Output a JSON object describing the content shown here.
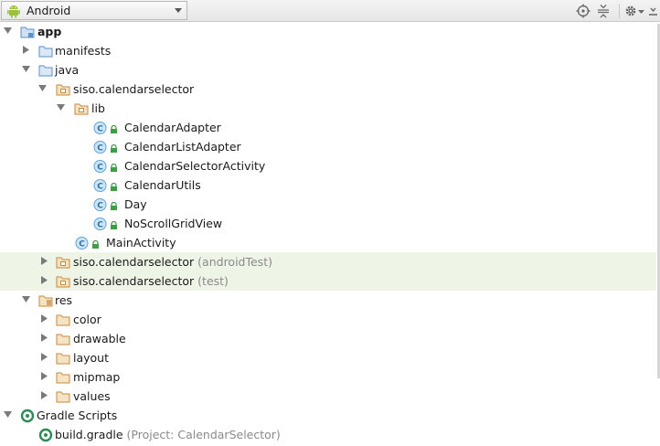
{
  "toolbar": {
    "view_label": "Android"
  },
  "tree": {
    "app": "app",
    "manifests": "manifests",
    "java": "java",
    "pkg_main": "siso.calendarselector",
    "lib": "lib",
    "classes": [
      "CalendarAdapter",
      "CalendarListAdapter",
      "CalendarSelectorActivity",
      "CalendarUtils",
      "Day",
      "NoScrollGridView"
    ],
    "main_activity": "MainActivity",
    "pkg_android_test": "siso.calendarselector",
    "android_test_hint": "(androidTest)",
    "pkg_test": "siso.calendarselector",
    "test_hint": "(test)",
    "res": "res",
    "res_items": [
      "color",
      "drawable",
      "layout",
      "mipmap",
      "values"
    ],
    "gradle_scripts": "Gradle Scripts",
    "build_gradle": "build.gradle",
    "build_gradle_hint": "(Project: CalendarSelector)"
  },
  "colors": {
    "folder_blue": "#5b8fc6",
    "package_orange": "#c98a3a",
    "class_circle": "#5fa3d9",
    "lock_green": "#3f9d48",
    "gradle_green": "#2e8b57",
    "highlight_row": "#eef4e6"
  }
}
